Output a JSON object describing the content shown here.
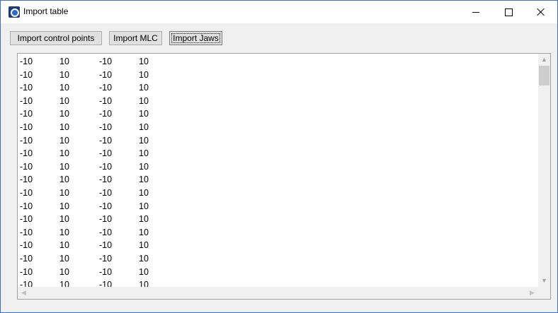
{
  "window": {
    "title": "Import table",
    "controls": {
      "minimize": "minimize",
      "maximize": "maximize",
      "close": "close"
    }
  },
  "toolbar": {
    "import_control_points": "Import control points",
    "import_mlc": "Import MLC",
    "import_jaws": "Import Jaws"
  },
  "table": {
    "rows": [
      [
        "-10",
        "10",
        "-10",
        "10"
      ],
      [
        "-10",
        "10",
        "-10",
        "10"
      ],
      [
        "-10",
        "10",
        "-10",
        "10"
      ],
      [
        "-10",
        "10",
        "-10",
        "10"
      ],
      [
        "-10",
        "10",
        "-10",
        "10"
      ],
      [
        "-10",
        "10",
        "-10",
        "10"
      ],
      [
        "-10",
        "10",
        "-10",
        "10"
      ],
      [
        "-10",
        "10",
        "-10",
        "10"
      ],
      [
        "-10",
        "10",
        "-10",
        "10"
      ],
      [
        "-10",
        "10",
        "-10",
        "10"
      ],
      [
        "-10",
        "10",
        "-10",
        "10"
      ],
      [
        "-10",
        "10",
        "-10",
        "10"
      ],
      [
        "-10",
        "10",
        "-10",
        "10"
      ],
      [
        "-10",
        "10",
        "-10",
        "10"
      ],
      [
        "-10",
        "10",
        "-10",
        "10"
      ],
      [
        "-10",
        "10",
        "-10",
        "10"
      ],
      [
        "-10",
        "10",
        "-10",
        "10"
      ],
      [
        "-10",
        "10",
        "-10",
        "10"
      ]
    ]
  },
  "colors": {
    "window_border": "#3c6fd6",
    "button_face": "#e1e1e1",
    "scroll_thumb": "#cdcdcd"
  }
}
